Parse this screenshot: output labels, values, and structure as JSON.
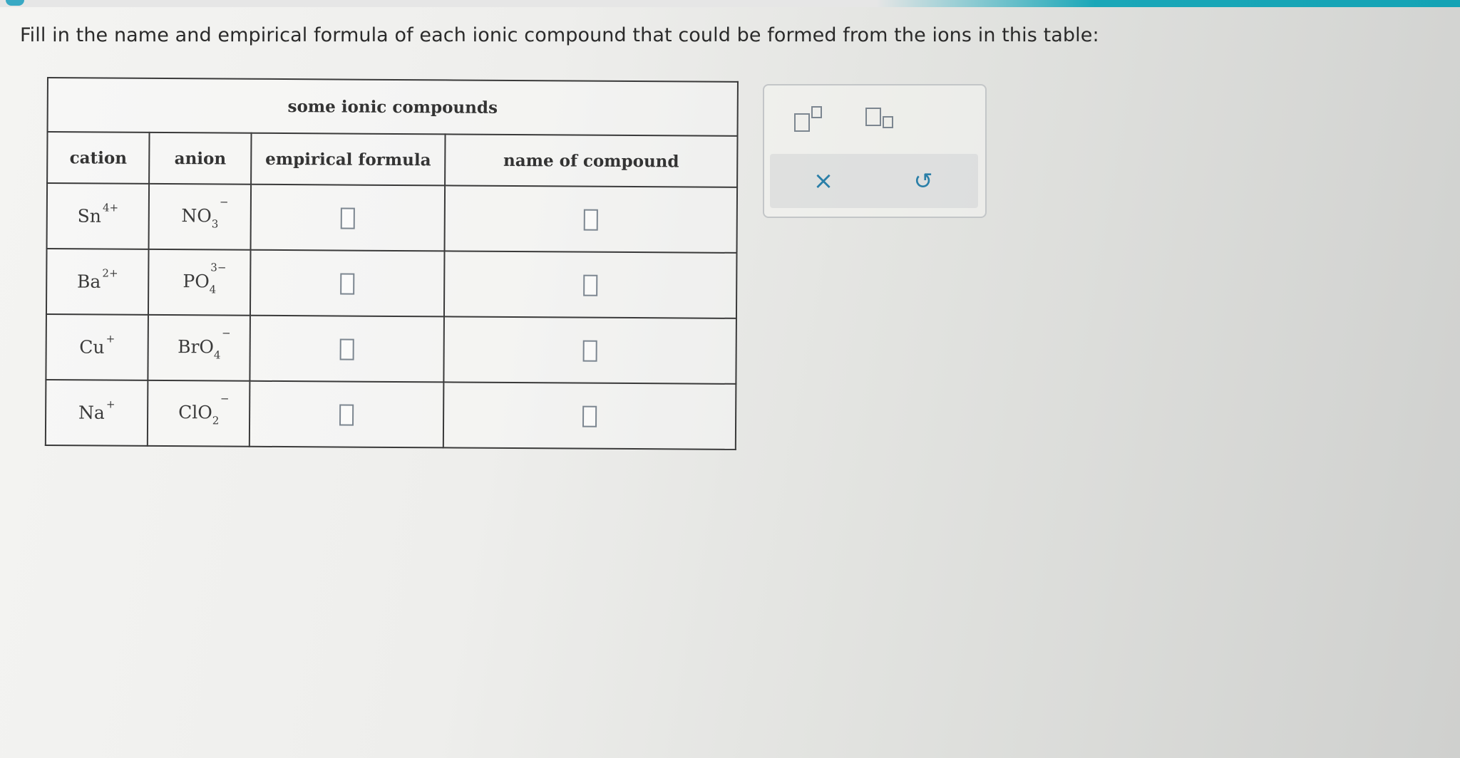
{
  "prompt": "Fill in the name and empirical formula of each ionic compound that could be formed from the ions in this table:",
  "table": {
    "caption": "some ionic compounds",
    "headers": {
      "cation": "cation",
      "anion": "anion",
      "formula": "empirical formula",
      "name": "name of compound"
    },
    "rows": [
      {
        "cation": {
          "symbol": "Sn",
          "charge": "4+"
        },
        "anion": {
          "symbol": "NO",
          "sub": "3",
          "charge": "−"
        }
      },
      {
        "cation": {
          "symbol": "Ba",
          "charge": "2+"
        },
        "anion": {
          "symbol": "PO",
          "sub": "4",
          "charge": "3−"
        }
      },
      {
        "cation": {
          "symbol": "Cu",
          "charge": "+"
        },
        "anion": {
          "symbol": "BrO",
          "sub": "4",
          "charge": "−"
        }
      },
      {
        "cation": {
          "symbol": "Na",
          "charge": "+"
        },
        "anion": {
          "symbol": "ClO",
          "sub": "2",
          "charge": "−"
        }
      }
    ]
  },
  "toolbar": {
    "superscript_icon": "superscript-icon",
    "subscript_icon": "subscript-icon",
    "clear_symbol": "×",
    "undo_symbol": "↺"
  },
  "colors": {
    "accent": "#1aa7b8",
    "action_icon": "#2a7fa8"
  }
}
